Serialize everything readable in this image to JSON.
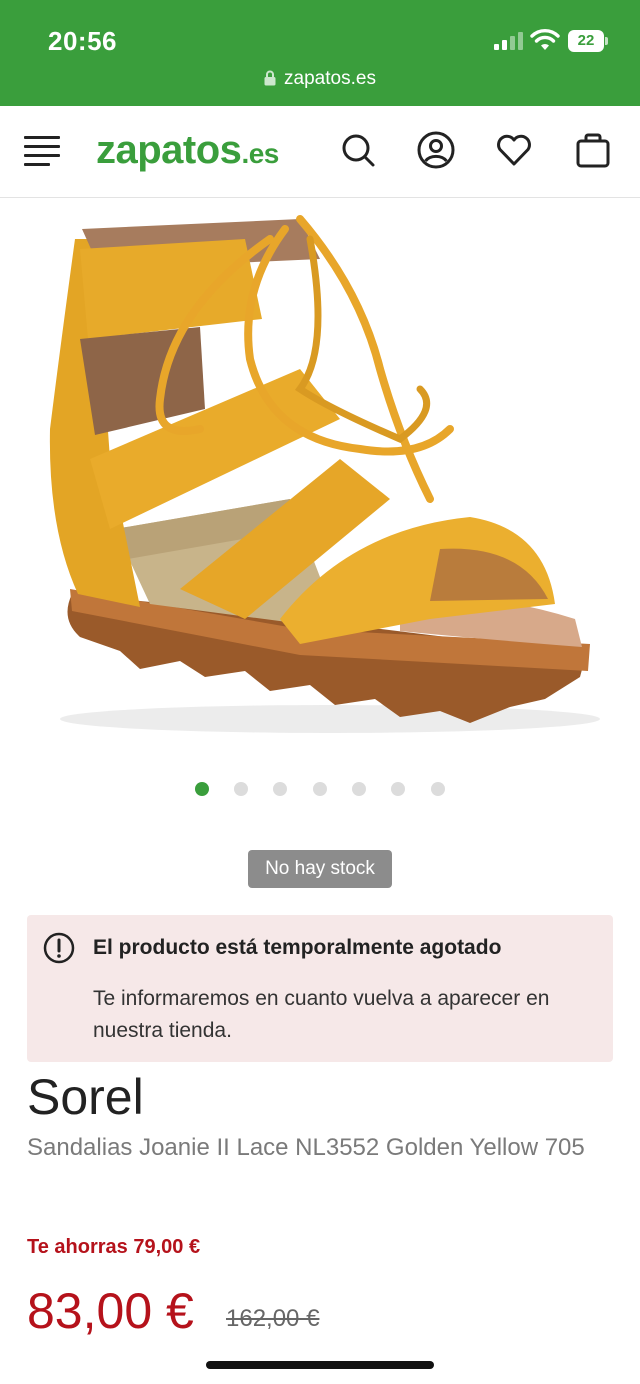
{
  "status_bar": {
    "time": "20:56",
    "battery": "22",
    "url": "zapatos.es"
  },
  "header": {
    "logo_main": "zapatos",
    "logo_tld": ".es",
    "brand_color": "#3a9e3c",
    "icons": [
      "menu-icon",
      "search-icon",
      "account-icon",
      "heart-icon",
      "bag-icon"
    ]
  },
  "gallery": {
    "image_description_icon": "sandal-image",
    "slide_count": 7,
    "active_slide": 1
  },
  "stock": {
    "badge": "No hay stock"
  },
  "alert": {
    "title": "El producto está temporalmente agotado",
    "text": "Te informaremos en cuanto vuelva a aparecer en nuestra tienda.",
    "background": "#f6e8e8"
  },
  "product": {
    "brand": "Sorel",
    "name": "Sandalias Joanie II Lace NL3552 Golden Yellow 705",
    "savings": "Te ahorras 79,00 €",
    "price": "83,00 €",
    "old_price": "162,00 €",
    "price_color": "#b5121b"
  }
}
